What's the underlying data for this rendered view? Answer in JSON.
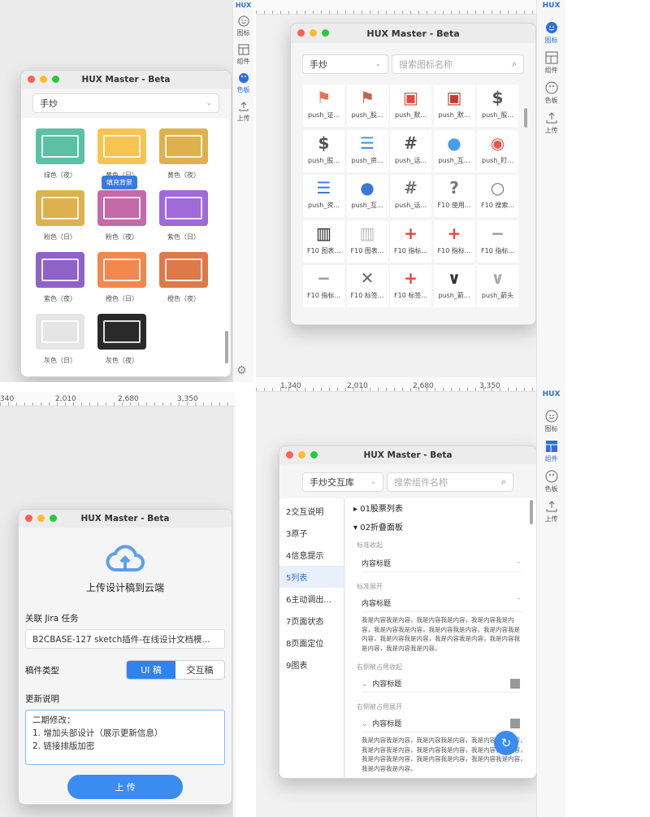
{
  "app": {
    "title": "HUX Master - Beta",
    "logo": "HUX",
    "accent": "#2f6fd6"
  },
  "rail": {
    "icons_label": "图标",
    "components_label": "组件",
    "colors_label": "色板",
    "upload_label": "上传"
  },
  "rulers": {
    "top_right": [
      "1,340",
      "2,010",
      "2,680",
      "3,350"
    ],
    "mid_left": [
      "340",
      "2,010",
      "2,680",
      "3,350"
    ]
  },
  "colors_window": {
    "dropdown": "手炒",
    "tooltip": "填充背景",
    "swatches": [
      {
        "label": "绿色（夜）",
        "color": "#5cc0a4"
      },
      {
        "label": "黄色（日）",
        "color": "#f6c453"
      },
      {
        "label": "黄色（夜）",
        "color": "#ddb24e"
      },
      {
        "label": "粉色（日）",
        "color": "#ddb24e"
      },
      {
        "label": "粉色（夜）",
        "color": "#c46aa8"
      },
      {
        "label": "紫色（日）",
        "color": "#a06ad8"
      },
      {
        "label": "紫色（夜）",
        "color": "#8f62c8"
      },
      {
        "label": "橙色（日）",
        "color": "#f2884e"
      },
      {
        "label": "橙色（夜）",
        "color": "#de7a48"
      },
      {
        "label": "灰色（日）",
        "color": "#e5e5e5"
      },
      {
        "label": "灰色（夜）",
        "color": "#2a2a2a"
      }
    ]
  },
  "icons_window": {
    "dropdown": "手炒",
    "search_placeholder": "搜索图标名称",
    "icons": [
      {
        "label": "push_证...",
        "glyph": "⚑",
        "color": "#e8735a"
      },
      {
        "label": "push_股...",
        "glyph": "⚑",
        "color": "#c9604a"
      },
      {
        "label": "push_默...",
        "glyph": "▣",
        "color": "#e04a3c"
      },
      {
        "label": "push_默...",
        "glyph": "▣",
        "color": "#c23a30"
      },
      {
        "label": "push_股...",
        "glyph": "$",
        "color": "#555555"
      },
      {
        "label": "push_股...",
        "glyph": "$",
        "color": "#555555"
      },
      {
        "label": "push_资...",
        "glyph": "☰",
        "color": "#4a8ee8"
      },
      {
        "label": "push_话...",
        "glyph": "#",
        "color": "#555555"
      },
      {
        "label": "push_互...",
        "glyph": "●",
        "color": "#4a9ee8"
      },
      {
        "label": "push_盯...",
        "glyph": "◉",
        "color": "#e8574a"
      },
      {
        "label": "push_资...",
        "glyph": "☰",
        "color": "#3a78d8"
      },
      {
        "label": "push_互...",
        "glyph": "●",
        "color": "#3a78d8"
      },
      {
        "label": "push_话...",
        "glyph": "#",
        "color": "#777777"
      },
      {
        "label": "F10 使用...",
        "glyph": "?",
        "color": "#777777"
      },
      {
        "label": "F10 搜索...",
        "glyph": "○",
        "color": "#777777"
      },
      {
        "label": "F10 图表...",
        "glyph": "▥",
        "color": "#222222"
      },
      {
        "label": "F10 图表...",
        "glyph": "▥",
        "color": "#bbbbbb"
      },
      {
        "label": "F10 指标...",
        "glyph": "+",
        "color": "#e04a3c"
      },
      {
        "label": "F10 指标...",
        "glyph": "+",
        "color": "#e04a3c"
      },
      {
        "label": "F10 指标...",
        "glyph": "−",
        "color": "#999999"
      },
      {
        "label": "F10 指标...",
        "glyph": "−",
        "color": "#999999"
      },
      {
        "label": "F10 标签...",
        "glyph": "✕",
        "color": "#666666"
      },
      {
        "label": "F10 标签...",
        "glyph": "+",
        "color": "#e04a3c"
      },
      {
        "label": "push_箭...",
        "glyph": "∨",
        "color": "#333333"
      },
      {
        "label": "push_箭头",
        "glyph": "∨",
        "color": "#aaaaaa"
      }
    ]
  },
  "upload_window": {
    "heading": "上传设计稿到云端",
    "jira_label": "关联 Jira 任务",
    "jira_value": "B2CBASE-127 sketch插件-在线设计文档模...",
    "type_label": "稿件类型",
    "type_options": [
      "UI 稿",
      "交互稿"
    ],
    "notes_label": "更新说明",
    "notes_lines": [
      "二期修改：",
      "1. 增加头部设计（展示更新信息）",
      "2. 链接排版加密"
    ],
    "upload_button": "上 传"
  },
  "components_window": {
    "dropdown": "手炒交互库",
    "search_placeholder": "搜索组件名称",
    "nav": [
      "2交互说明",
      "3原子",
      "4信息提示",
      "5列表",
      "6主动调出...",
      "7页面状态",
      "8页面定位",
      "9图表"
    ],
    "active_nav_index": 3,
    "tree": {
      "collapsed": "01股票列表",
      "expanded": "02折叠面板"
    },
    "sections": {
      "standard_collapsed": "标准收起",
      "standard_expanded": "标准展开",
      "right_collapsed": "右侧被占用收起",
      "right_expanded": "右侧被占用展开",
      "item_title": "内容标题",
      "body_text": "我是内容我是内容，我是内容我是内容，我是内容我是内容，我是内容我是内容，我是内容我是内容，我是内容我是内容，我是内容我是内容，我是内容我是内容，我是内容我是内容，我是内容我是内容。",
      "body_text_short": "我是内容我是内容，我是内容我是内容，我是内容我是内容，我是内容我是内容，我是内容我是内容，我是内容我是内容，我是内容我是内容，我是内容我是内容，我是内容我是内容，我是内容我是内容。"
    }
  }
}
